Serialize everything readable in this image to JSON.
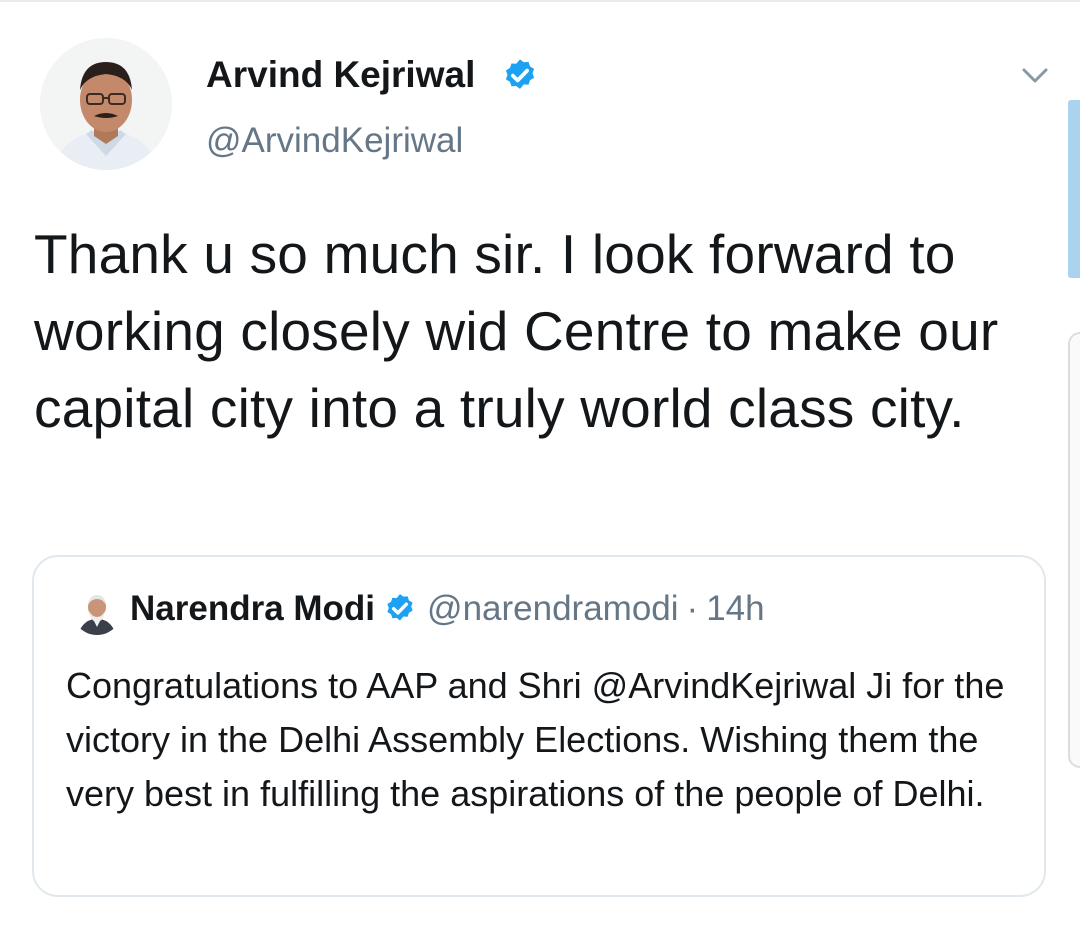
{
  "tweet": {
    "author": {
      "name": "Arvind Kejriwal",
      "handle": "@ArvindKejriwal",
      "verified": true
    },
    "text": "Thank u so much sir. I look forward to working closely wid Centre to make our capital city into a truly world class city.",
    "menu_icon": "chevron-down-icon"
  },
  "quoted_tweet": {
    "author": {
      "name": "Narendra Modi",
      "handle": "@narendramodi",
      "verified": true
    },
    "separator": "·",
    "time": "14h",
    "text": "Congratulations to AAP and Shri @ArvindKejriwal Ji for the victory in the Delhi Assembly Elections. Wishing them the very best in fulfilling the aspirations of the people of Delhi."
  },
  "colors": {
    "text_primary": "#14171a",
    "text_secondary": "#657786",
    "verified_blue": "#1da1f2",
    "border": "#e1e8ed"
  }
}
